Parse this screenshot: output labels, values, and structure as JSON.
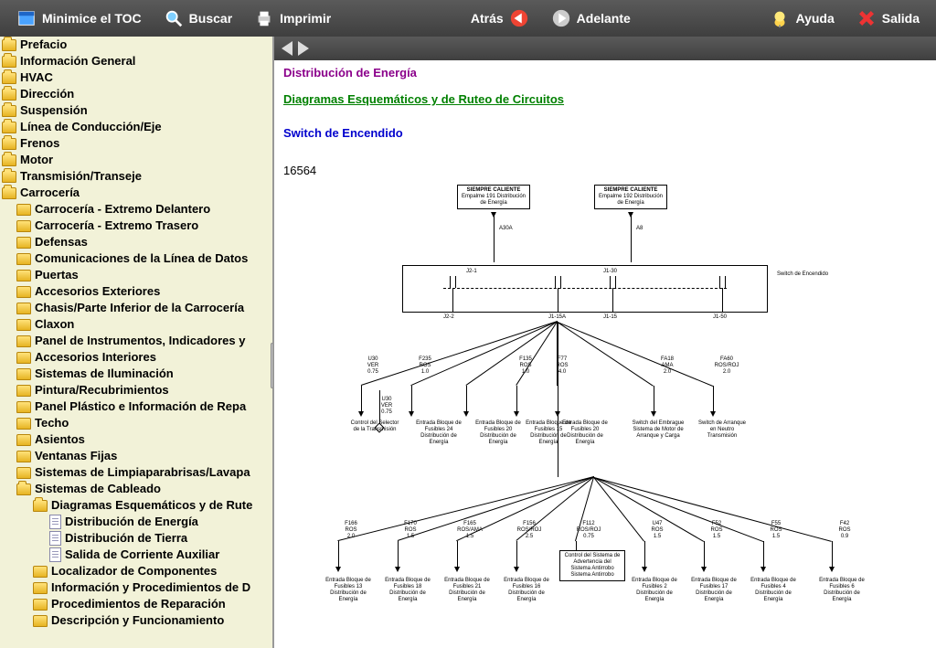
{
  "toolbar": {
    "minimize_toc": "Minimice el TOC",
    "search": "Buscar",
    "print": "Imprimir",
    "back": "Atrás",
    "forward": "Adelante",
    "help": "Ayuda",
    "exit": "Salida"
  },
  "tree": {
    "items": [
      {
        "lvl": 1,
        "icon": "folder-open",
        "label": "Prefacio"
      },
      {
        "lvl": 1,
        "icon": "folder-open",
        "label": "Información General"
      },
      {
        "lvl": 1,
        "icon": "folder-open",
        "label": "HVAC"
      },
      {
        "lvl": 1,
        "icon": "folder-open",
        "label": "Dirección"
      },
      {
        "lvl": 1,
        "icon": "folder-open",
        "label": "Suspensión"
      },
      {
        "lvl": 1,
        "icon": "folder-open",
        "label": "Línea de Conducción/Eje"
      },
      {
        "lvl": 1,
        "icon": "folder-open",
        "label": "Frenos"
      },
      {
        "lvl": 1,
        "icon": "folder-open",
        "label": "Motor"
      },
      {
        "lvl": 1,
        "icon": "folder-open",
        "label": "Transmisión/Transeje"
      },
      {
        "lvl": 1,
        "icon": "folder-open",
        "label": "Carrocería"
      },
      {
        "lvl": 2,
        "icon": "folder",
        "label": "Carrocería - Extremo Delantero"
      },
      {
        "lvl": 2,
        "icon": "folder",
        "label": "Carrocería - Extremo Trasero"
      },
      {
        "lvl": 2,
        "icon": "folder",
        "label": "Defensas"
      },
      {
        "lvl": 2,
        "icon": "folder",
        "label": "Comunicaciones de la Línea de Datos"
      },
      {
        "lvl": 2,
        "icon": "folder",
        "label": "Puertas"
      },
      {
        "lvl": 2,
        "icon": "folder",
        "label": "Accesorios Exteriores"
      },
      {
        "lvl": 2,
        "icon": "folder",
        "label": "Chasis/Parte Inferior de la Carrocería"
      },
      {
        "lvl": 2,
        "icon": "folder",
        "label": "Claxon"
      },
      {
        "lvl": 2,
        "icon": "folder",
        "label": "Panel de Instrumentos, Indicadores y"
      },
      {
        "lvl": 2,
        "icon": "folder",
        "label": "Accesorios Interiores"
      },
      {
        "lvl": 2,
        "icon": "folder",
        "label": "Sistemas de Iluminación"
      },
      {
        "lvl": 2,
        "icon": "folder",
        "label": "Pintura/Recubrimientos"
      },
      {
        "lvl": 2,
        "icon": "folder",
        "label": "Panel Plástico e Información de Repa"
      },
      {
        "lvl": 2,
        "icon": "folder",
        "label": "Techo"
      },
      {
        "lvl": 2,
        "icon": "folder",
        "label": "Asientos"
      },
      {
        "lvl": 2,
        "icon": "folder",
        "label": "Ventanas Fijas"
      },
      {
        "lvl": 2,
        "icon": "folder",
        "label": "Sistemas de Limpiaparabrisas/Lavapa"
      },
      {
        "lvl": 2,
        "icon": "folder-open",
        "label": "Sistemas de Cableado"
      },
      {
        "lvl": 3,
        "icon": "folder-open",
        "label": "Diagramas Esquemáticos y de Rute"
      },
      {
        "lvl": 4,
        "icon": "doc",
        "label": "Distribución de Energía"
      },
      {
        "lvl": 4,
        "icon": "doc",
        "label": "Distribución de Tierra"
      },
      {
        "lvl": 4,
        "icon": "doc",
        "label": "Salida de Corriente Auxiliar"
      },
      {
        "lvl": 3,
        "icon": "folder",
        "label": "Localizador de Componentes"
      },
      {
        "lvl": 3,
        "icon": "folder",
        "label": "Información y Procedimientos de D"
      },
      {
        "lvl": 3,
        "icon": "folder",
        "label": "Procedimientos de Reparación"
      },
      {
        "lvl": 3,
        "icon": "folder",
        "label": "Descripción y Funcionamiento"
      }
    ]
  },
  "document": {
    "breadcrumb1": "Distribución de Energía",
    "breadcrumb2": "Diagramas Esquemáticos y de Ruteo de Circuitos",
    "heading": "Switch de Encendido",
    "figure_number": "16564",
    "diagram": {
      "top_boxes": [
        {
          "title": "SIEMPRE CALIENTE",
          "sub": "Empalme 191 Distribución de Energía"
        },
        {
          "title": "SIEMPRE CALIENTE",
          "sub": "Empalme 192 Distribución de Energía"
        }
      ],
      "switch_label": "Switch de Encendido",
      "jlabels": [
        "J2-1",
        "J1-30",
        "J2-2",
        "J1-15A",
        "J1-15",
        "J1-50"
      ],
      "mid_wires": [
        {
          "name": "U30",
          "color": "VER",
          "gauge": "0.75"
        },
        {
          "name": "F235",
          "color": "ROS",
          "gauge": "1.0"
        },
        {
          "name": "F135",
          "color": "ROS",
          "gauge": "1.0"
        },
        {
          "name": "F77",
          "color": "ROS",
          "gauge": "4.0"
        },
        {
          "name": "FA18",
          "color": "AMA",
          "gauge": "2.0"
        },
        {
          "name": "FA60",
          "color": "ROS/ROJ",
          "gauge": "2.0"
        }
      ],
      "mid_targets": [
        "Control del Selector de la Transmisión",
        "Entrada Bloque de Fusibles 24 Distribución de Energía",
        "Entrada Bloque de Fusibles 20 Distribución de Energía",
        "Entrada Bloque de Fusibles 15 Distribución de Energía",
        "Entrada Bloque de Fusibles 20 Distribución de Energía",
        "Switch del Embrague Sistema de Motor de Arranque y Carga",
        "Switch de Arranque en Neutro Transmisión"
      ],
      "u30b": {
        "name": "U30",
        "color": "VER",
        "gauge": "0.75"
      },
      "bottom_wires": [
        {
          "name": "F166",
          "color": "ROS",
          "gauge": "2.0"
        },
        {
          "name": "F170",
          "color": "ROS",
          "gauge": "1.5"
        },
        {
          "name": "F165",
          "color": "ROS/AMA",
          "gauge": "1.5"
        },
        {
          "name": "F156",
          "color": "ROS/ROJ",
          "gauge": "2.5"
        },
        {
          "name": "F112",
          "color": "ROS/ROJ",
          "gauge": "0.75"
        },
        {
          "name": "U47",
          "color": "ROS",
          "gauge": "1.5"
        },
        {
          "name": "F52",
          "color": "ROS",
          "gauge": "1.5"
        },
        {
          "name": "F55",
          "color": "ROS",
          "gauge": "1.5"
        },
        {
          "name": "F42",
          "color": "ROS",
          "gauge": "0.9"
        }
      ],
      "bottom_targets": [
        "Entrada Bloque de Fusibles 13 Distribución de Energía",
        "Entrada Bloque de Fusibles 18 Distribución de Energía",
        "Entrada Bloque de Fusibles 21 Distribución de Energía",
        "Entrada Bloque de Fusibles 16 Distribución de Energía",
        "Control del Sistema de Advertencia del Sistema Antirrobo Sistema Antirrobo",
        "Entrada Bloque de Fusibles 2 Distribución de Energía",
        "Entrada Bloque de Fusibles 17 Distribución de Energía",
        "Entrada Bloque de Fusibles 4 Distribución de Energía",
        "Entrada Bloque de Fusibles 6 Distribución de Energía"
      ]
    }
  }
}
